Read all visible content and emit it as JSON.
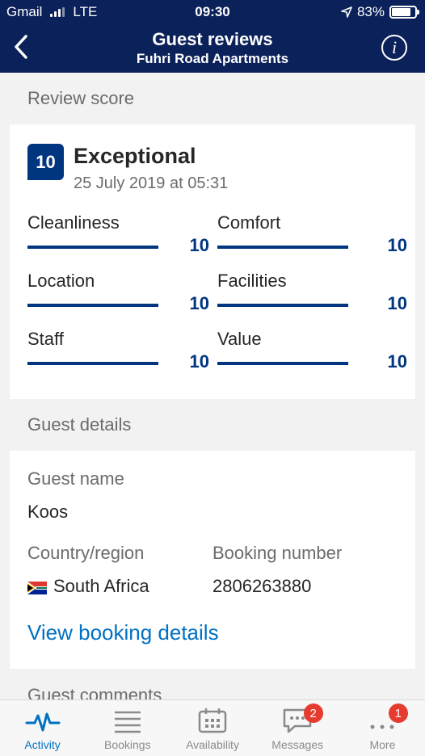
{
  "status_bar": {
    "carrier": "Gmail",
    "network": "LTE",
    "time": "09:30",
    "battery": "83%",
    "battery_level": 0.83
  },
  "header": {
    "title": "Guest reviews",
    "subtitle": "Fuhri Road Apartments"
  },
  "review": {
    "section_title": "Review score",
    "score": "10",
    "word": "Exceptional",
    "date": "25 July 2019 at 05:31",
    "ratings": [
      {
        "label": "Cleanliness",
        "value": "10",
        "fraction": 1.0
      },
      {
        "label": "Comfort",
        "value": "10",
        "fraction": 1.0
      },
      {
        "label": "Location",
        "value": "10",
        "fraction": 1.0
      },
      {
        "label": "Facilities",
        "value": "10",
        "fraction": 1.0
      },
      {
        "label": "Staff",
        "value": "10",
        "fraction": 1.0
      },
      {
        "label": "Value",
        "value": "10",
        "fraction": 1.0
      }
    ]
  },
  "guest": {
    "section_title": "Guest details",
    "name_label": "Guest name",
    "name": "Koos",
    "country_label": "Country/region",
    "country": "South Africa",
    "booking_label": "Booking number",
    "booking_number": "2806263880",
    "link": "View booking details"
  },
  "comments": {
    "section_title": "Guest comments"
  },
  "tabs": [
    {
      "label": "Activity",
      "icon": "activity-icon",
      "active": true,
      "badge": ""
    },
    {
      "label": "Bookings",
      "icon": "list-icon",
      "active": false,
      "badge": ""
    },
    {
      "label": "Availability",
      "icon": "calendar-icon",
      "active": false,
      "badge": ""
    },
    {
      "label": "Messages",
      "icon": "chat-icon",
      "active": false,
      "badge": "2"
    },
    {
      "label": "More",
      "icon": "more-icon",
      "active": false,
      "badge": "1"
    }
  ],
  "colors": {
    "header": "#0b2159",
    "accent": "#003580",
    "link": "#0071c2",
    "badge": "#e63b2e"
  }
}
